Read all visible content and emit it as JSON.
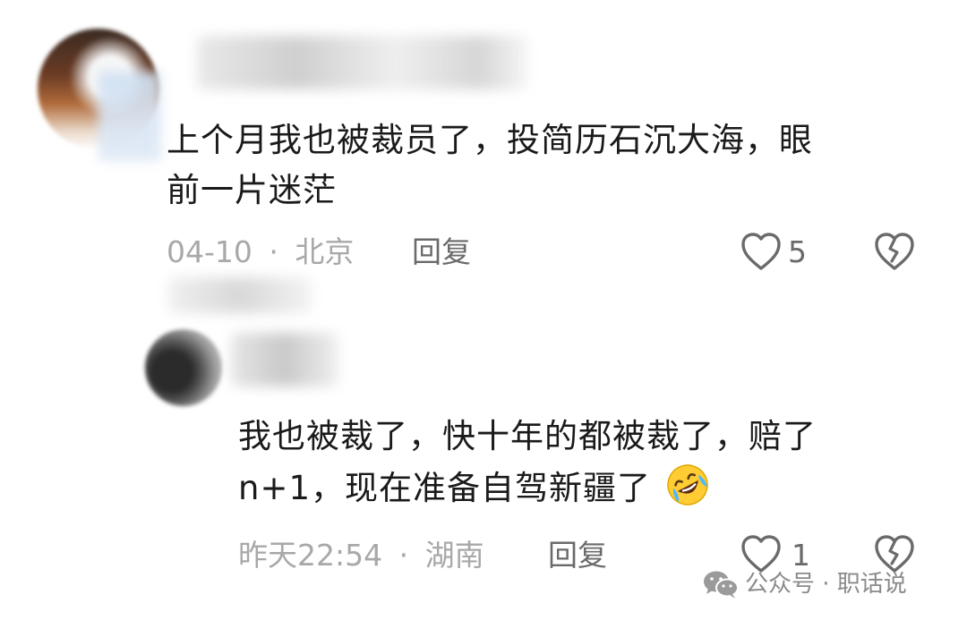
{
  "comments": [
    {
      "text_line1": "上个月我也被裁员了，投简历石沉大海，眼",
      "text_line2": "前一片迷茫",
      "date": "04-10",
      "separator": "·",
      "location": "北京",
      "reply_label": "回复",
      "likes": "5"
    },
    {
      "text_line1": "我也被裁了，快十年的都被裁了，赔了",
      "text_line2": "n+1，现在准备自驾新疆了",
      "emoji_icon": "rofl-emoji-icon",
      "date": "昨天22:54",
      "separator": "·",
      "location": "湖南",
      "reply_label": "回复",
      "likes": "1"
    }
  ],
  "watermark": {
    "label": "公众号 · 职话说",
    "icon": "wechat-logo-icon"
  },
  "colors": {
    "text": "#1a1a1a",
    "meta": "#a8a8a8",
    "action": "#6a6a6a"
  }
}
